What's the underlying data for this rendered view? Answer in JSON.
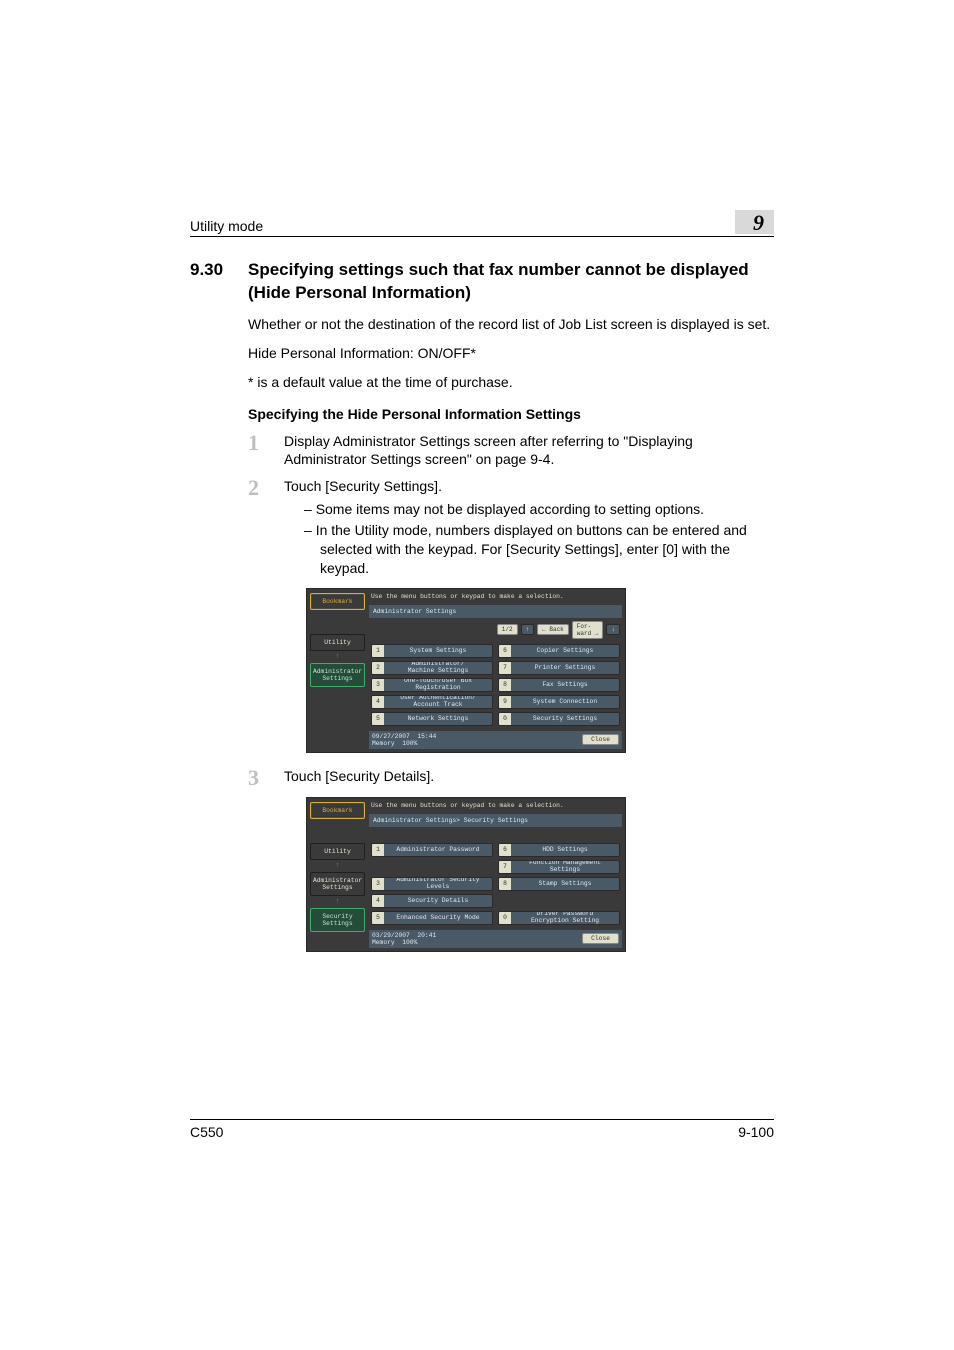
{
  "header": {
    "running_title": "Utility mode",
    "chapter_number": "9"
  },
  "section": {
    "number": "9.30",
    "title": "Specifying settings such that fax number cannot be displayed (Hide Personal Information)",
    "para1": "Whether or not the destination of the record list of Job List screen is displayed is set.",
    "para2": "Hide Personal Information: ON/OFF*",
    "para3": "* is a default value at the time of purchase.",
    "subheading": "Specifying the Hide Personal Information Settings"
  },
  "steps": {
    "s1": {
      "num": "1",
      "text": "Display Administrator Settings screen after referring to \"Displaying Administrator Settings screen\" on page 9-4."
    },
    "s2": {
      "num": "2",
      "text": "Touch [Security Settings].",
      "bullets": [
        "Some items may not be displayed according to setting options.",
        "In the Utility mode, numbers displayed on buttons can be entered and selected with the keypad. For [Security Settings], enter [0] with the keypad."
      ]
    },
    "s3": {
      "num": "3",
      "text": "Touch [Security Details]."
    }
  },
  "screenshot_common": {
    "instruction": "Use the menu buttons or keypad to make a selection.",
    "bookmark": "Bookmark",
    "close": "Close",
    "page_indicator": "1/2",
    "nav_up": "↑",
    "nav_back": "← Back",
    "nav_fwd1": "For-\nward →",
    "nav_fwd2": "↓"
  },
  "screenshot1": {
    "title": "Administrator Settings",
    "sidebar": {
      "utility": "Utility",
      "admin": "Administrator\nSettings"
    },
    "rows_left": [
      {
        "n": "1",
        "t": "System Settings"
      },
      {
        "n": "2",
        "t": "Administrator/\nMachine Settings"
      },
      {
        "n": "3",
        "t": "One-Touch/User Box\nRegistration"
      },
      {
        "n": "4",
        "t": "User Authentication/\nAccount Track"
      },
      {
        "n": "5",
        "t": "Network Settings"
      }
    ],
    "rows_right": [
      {
        "n": "6",
        "t": "Copier Settings"
      },
      {
        "n": "7",
        "t": "Printer Settings"
      },
      {
        "n": "8",
        "t": "Fax Settings"
      },
      {
        "n": "9",
        "t": "System Connection"
      },
      {
        "n": "0",
        "t": "Security Settings"
      }
    ],
    "status": {
      "date": "09/27/2007",
      "time": "15:44",
      "mem_label": "Memory",
      "mem_val": "100%"
    }
  },
  "screenshot2": {
    "title": "Administrator Settings> Security Settings",
    "sidebar": {
      "utility": "Utility",
      "admin": "Administrator\nSettings",
      "sec": "Security\nSettings"
    },
    "rows_left": [
      {
        "n": "1",
        "t": "Administrator Password"
      },
      {
        "n": "",
        "t": ""
      },
      {
        "n": "3",
        "t": "Administrator Security\nLevels"
      },
      {
        "n": "4",
        "t": "Security Details"
      },
      {
        "n": "5",
        "t": "Enhanced Security Mode"
      }
    ],
    "rows_right": [
      {
        "n": "6",
        "t": "HDD Settings"
      },
      {
        "n": "7",
        "t": "Function Management Settings"
      },
      {
        "n": "8",
        "t": "Stamp Settings"
      },
      {
        "n": "",
        "t": ""
      },
      {
        "n": "0",
        "t": "Driver Password\nEncryption Setting"
      }
    ],
    "status": {
      "date": "03/29/2007",
      "time": "20:41",
      "mem_label": "Memory",
      "mem_val": "100%"
    }
  },
  "footer": {
    "model": "C550",
    "page": "9-100"
  }
}
